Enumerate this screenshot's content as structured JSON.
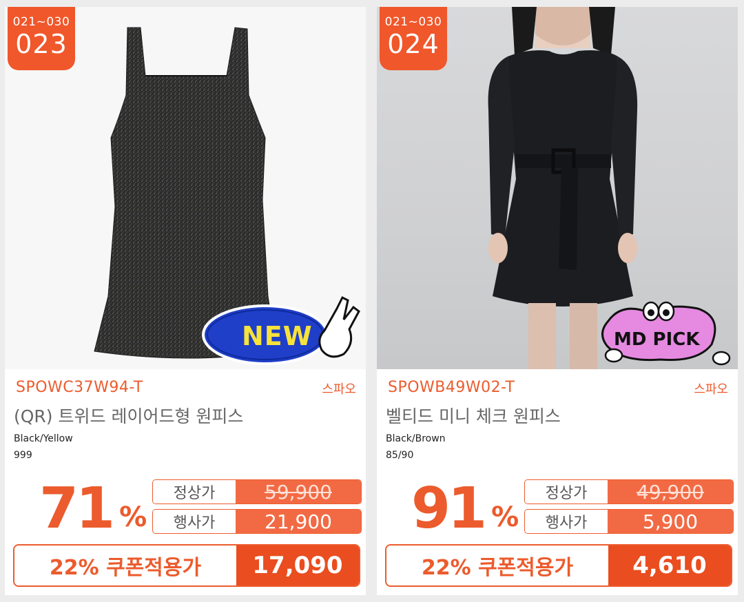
{
  "products": [
    {
      "rank_range": "021~030",
      "rank": "023",
      "sticker": "NEW",
      "code": "SPOWC37W94-T",
      "brand": "스파오",
      "name": "(QR) 트위드 레이어드형 원피스",
      "color": "Black/Yellow",
      "size": "999",
      "discount": "71",
      "discount_unit": "%",
      "regular_label": "정상가",
      "regular_price": "59,900",
      "event_label": "행사가",
      "event_price": "21,900",
      "coupon_label": "22% 쿠폰적용가",
      "coupon_price": "17,090"
    },
    {
      "rank_range": "021~030",
      "rank": "024",
      "sticker": "MD PICK",
      "code": "SPOWB49W02-T",
      "brand": "스파오",
      "name": "벨티드 미니 체크 원피스",
      "color": "Black/Brown",
      "size": "85/90",
      "discount": "91",
      "discount_unit": "%",
      "regular_label": "정상가",
      "regular_price": "49,900",
      "event_label": "행사가",
      "event_price": "5,900",
      "coupon_label": "22% 쿠폰적용가",
      "coupon_price": "4,610"
    }
  ],
  "colors": {
    "accent": "#ec5b2d",
    "price_fill": "#f26a44",
    "coupon_fill": "#ea4d1f",
    "new_sticker": "#1f3fc9",
    "new_text": "#f7e23a",
    "md_pick_sticker": "#e58ae0"
  }
}
